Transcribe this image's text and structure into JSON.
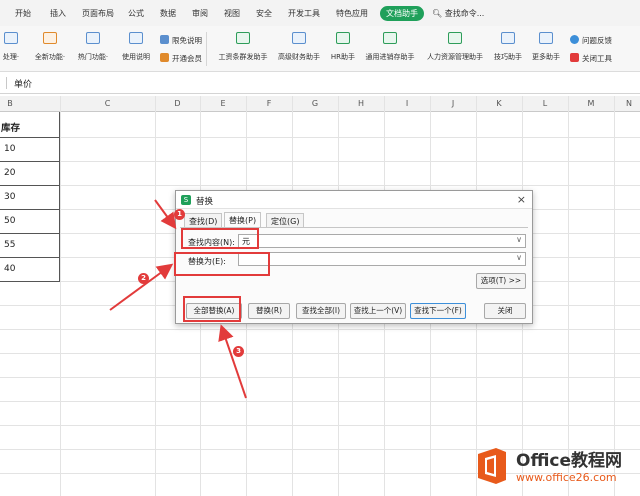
{
  "menu": {
    "items": [
      "开始",
      "插入",
      "页面布局",
      "公式",
      "数据",
      "审阅",
      "视图",
      "安全",
      "开发工具",
      "特色应用",
      "文档助手"
    ],
    "active_index": 10,
    "search": "查找命令..."
  },
  "ribbon": {
    "buttons": [
      {
        "label": "处理·",
        "icon": "process-icon"
      },
      {
        "label": "全新功能·",
        "icon": "new-feature-icon"
      },
      {
        "label": "热门功能·",
        "icon": "hot-feature-icon"
      },
      {
        "label": "使用说明",
        "icon": "instructions-icon"
      },
      {
        "label": "工资条群发助手",
        "icon": "payslip-icon"
      },
      {
        "label": "高级财务助手",
        "icon": "finance-icon"
      },
      {
        "label": "HR助手",
        "icon": "hr-icon"
      },
      {
        "label": "通用进销存助手",
        "icon": "inventory-icon"
      },
      {
        "label": "人力资源管理助手",
        "icon": "hr-manage-icon"
      },
      {
        "label": "技巧助手",
        "icon": "tips-icon"
      },
      {
        "label": "更多助手",
        "icon": "more-icon"
      }
    ],
    "small": {
      "free_note": "限免说明",
      "member": "开通会员",
      "feedback": "问题反馈",
      "close_tool": "关闭工具"
    }
  },
  "formula": {
    "value": "单价"
  },
  "columns": [
    "B",
    "C",
    "D",
    "E",
    "F",
    "G",
    "H",
    "I",
    "J",
    "K",
    "L",
    "M",
    "N"
  ],
  "colB": {
    "header": "库存",
    "values": [
      "10",
      "20",
      "30",
      "50",
      "55",
      "40"
    ]
  },
  "dialog": {
    "title": "替换",
    "close": "×",
    "tabs": [
      "查找(D)",
      "替换(P)",
      "定位(G)"
    ],
    "active_tab": 1,
    "find_label": "查找内容(N):",
    "find_value": "元",
    "replace_label": "替换为(E):",
    "replace_value": "",
    "options_button": "选项(T) >>",
    "buttons": [
      "全部替换(A)",
      "替换(R)",
      "查找全部(I)",
      "查找上一个(V)",
      "查找下一个(F)",
      "关闭"
    ]
  },
  "annotations": [
    "1",
    "2",
    "3"
  ],
  "watermark": {
    "line1": "Office教程网",
    "line2": "www.office26.com"
  },
  "colors": {
    "accent_green": "#1fa05a",
    "annotation_red": "#e23b3b",
    "watermark_orange": "#e85a1b"
  }
}
